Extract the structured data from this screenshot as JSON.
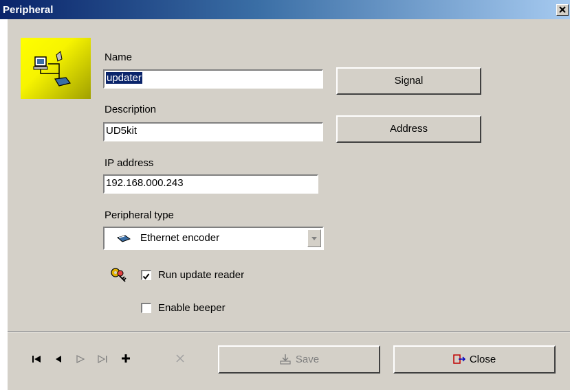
{
  "window": {
    "title": "Peripheral"
  },
  "form": {
    "name": {
      "label": "Name",
      "value": "updater"
    },
    "description": {
      "label": "Description",
      "value": "UD5kit"
    },
    "ip": {
      "label": "IP address",
      "value": "192.168.000.243"
    },
    "type": {
      "label": "Peripheral type",
      "value": "Ethernet encoder"
    },
    "run_update_reader": {
      "label": "Run update reader",
      "checked": true
    },
    "enable_beeper": {
      "label": "Enable beeper",
      "checked": false
    }
  },
  "buttons": {
    "signal": "Signal",
    "address": "Address",
    "save": "Save",
    "close": "Close"
  },
  "icons": [
    "network-peripheral-icon",
    "ethernet-device-icon",
    "keys-icon",
    "first-record-icon",
    "prev-record-icon",
    "next-record-icon",
    "last-record-icon",
    "add-record-icon",
    "delete-record-icon",
    "save-icon",
    "close-door-icon"
  ],
  "colors": {
    "titlebar_start": "#0a246a",
    "titlebar_end": "#a6caf0",
    "panel": "#d4d0c8",
    "tile": "#ffff00",
    "selection": "#0a246a"
  }
}
